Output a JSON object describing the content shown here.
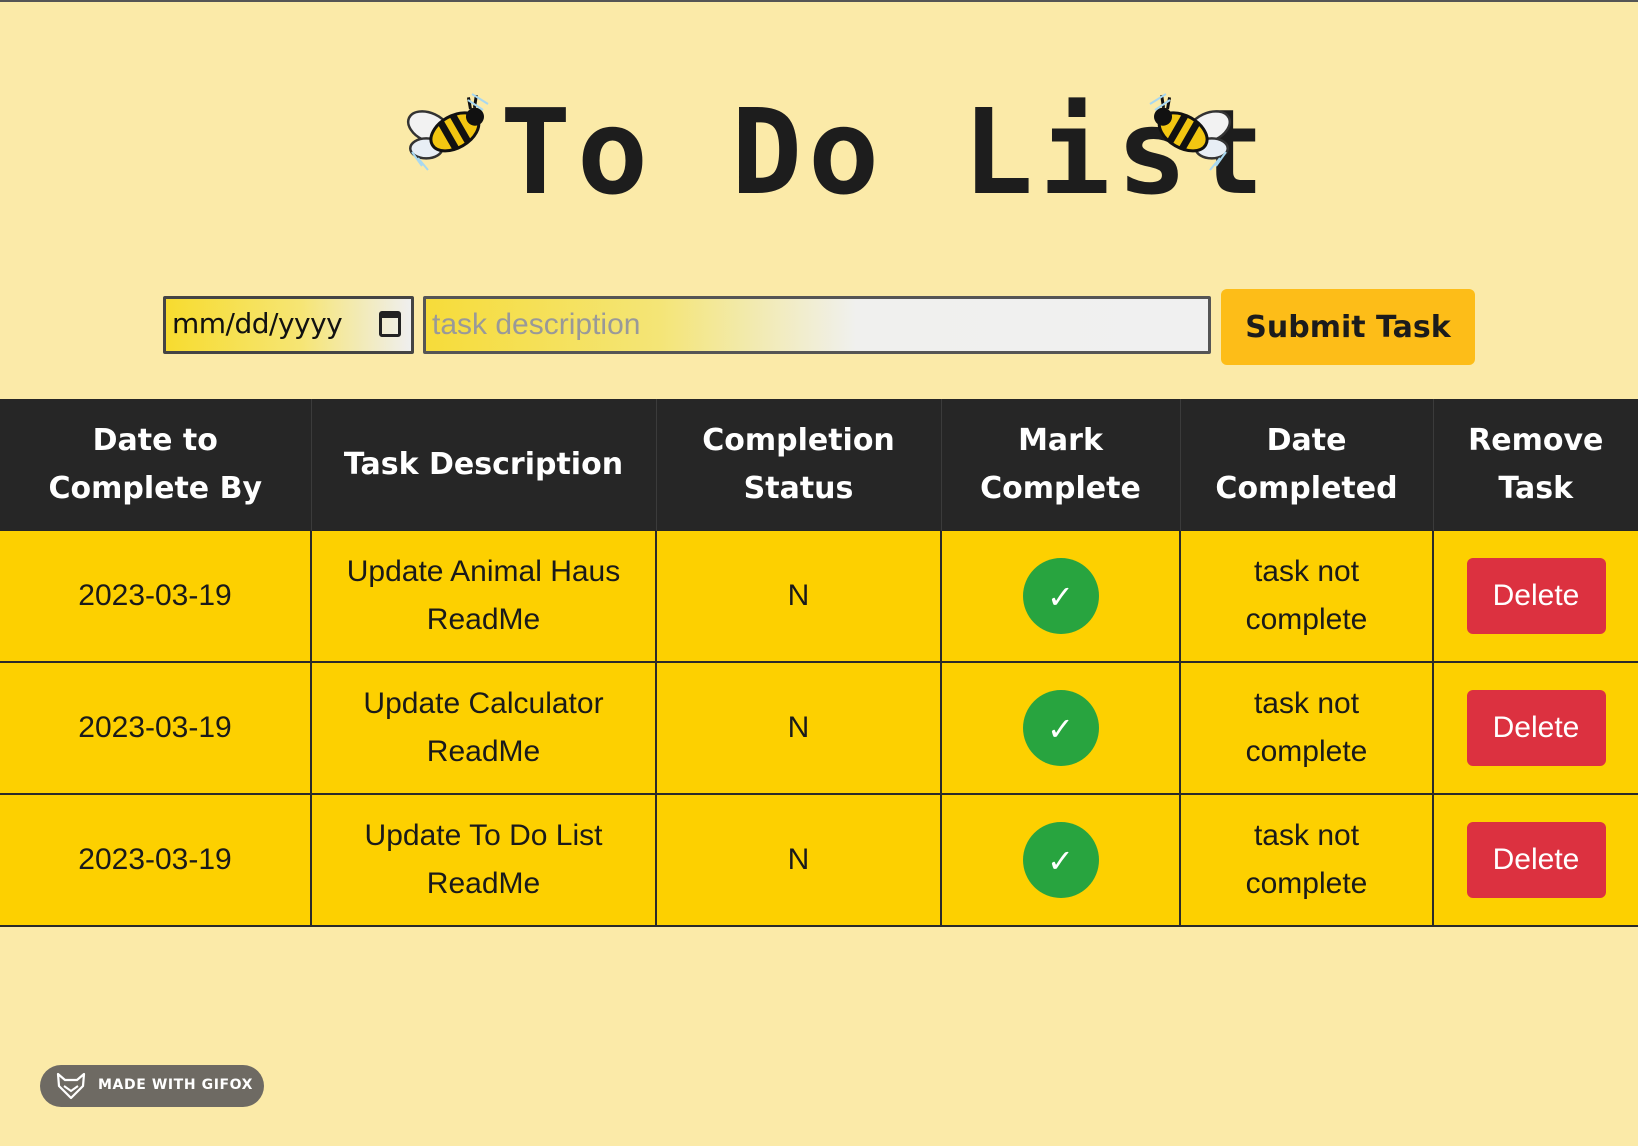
{
  "title": "To Do List",
  "icons": {
    "left_decoration": "bee-icon",
    "right_decoration": "bee-icon",
    "date_picker": "calendar-icon",
    "mark_complete": "checkmark-icon",
    "footer_logo": "fox-icon"
  },
  "form": {
    "date_placeholder": "mm/dd/yyyy",
    "task_placeholder": "task description",
    "task_value": "",
    "submit_label": "Submit Task"
  },
  "table": {
    "headers": [
      "Date to Complete By",
      "Task Description",
      "Completion Status",
      "Mark Complete",
      "Date Completed",
      "Remove Task"
    ],
    "rows": [
      {
        "date": "2023-03-19",
        "description": "Update Animal Haus ReadMe",
        "status": "N",
        "mark_label": "✓",
        "date_completed": "task not complete",
        "delete_label": "Delete"
      },
      {
        "date": "2023-03-19",
        "description": "Update Calculator ReadMe",
        "status": "N",
        "mark_label": "✓",
        "date_completed": "task not complete",
        "delete_label": "Delete"
      },
      {
        "date": "2023-03-19",
        "description": "Update To Do List ReadMe",
        "status": "N",
        "mark_label": "✓",
        "date_completed": "task not complete",
        "delete_label": "Delete"
      }
    ]
  },
  "footer": {
    "badge_text": "MADE WITH GIFOX"
  },
  "colors": {
    "background": "#fbeaa8",
    "header_bg": "#262626",
    "row_bg": "#fdd000",
    "submit_bg": "#fdbd18",
    "complete_green": "#28a43f",
    "delete_red": "#dc3140"
  }
}
